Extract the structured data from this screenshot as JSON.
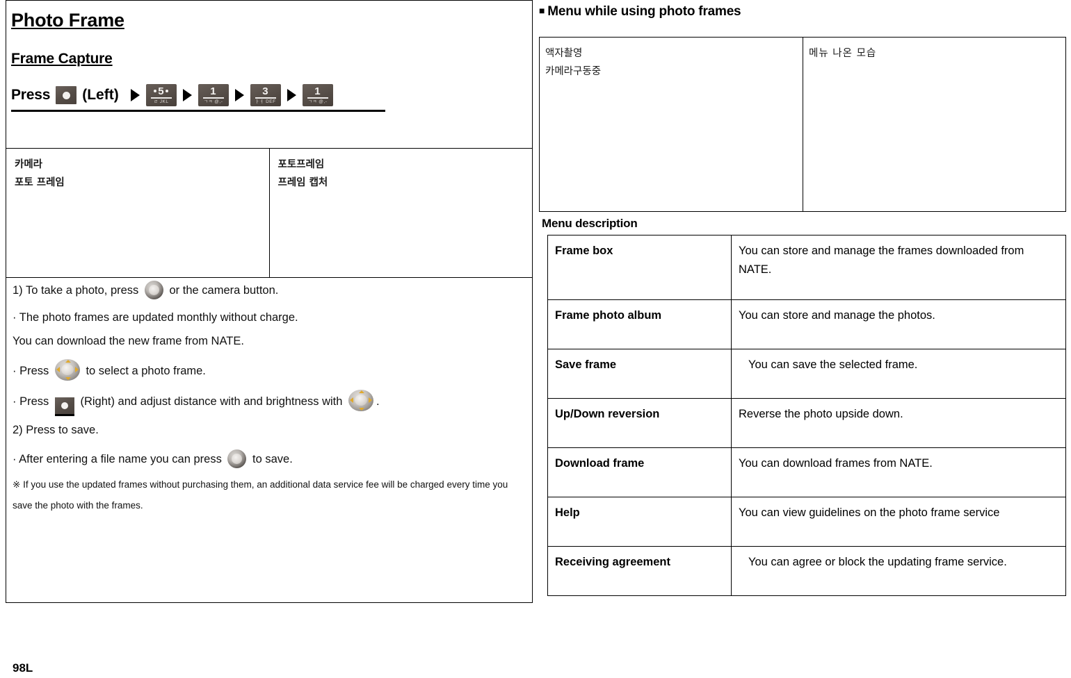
{
  "left": {
    "title": "Photo Frame",
    "subtitle": "Frame Capture",
    "press_label": "Press",
    "left_label": "(Left)",
    "key_sequence": [
      {
        "icon": "softkey-left",
        "digit": "",
        "sub": ""
      },
      {
        "icon": "numeric-key",
        "digit": "5",
        "sub": "ㄹ JKL",
        "dots": true
      },
      {
        "icon": "numeric-key",
        "digit": "1",
        "sub": "ㄱㅋ @,-",
        "dots": false
      },
      {
        "icon": "numeric-key",
        "digit": "3",
        "sub": "ㅏㅓ DEF",
        "dots": false
      },
      {
        "icon": "numeric-key",
        "digit": "1",
        "sub": "ㄱㅋ @,-",
        "dots": false
      }
    ],
    "screens": [
      {
        "line1": "카메라",
        "line2": "포토 프레임"
      },
      {
        "line1": "포토프레임",
        "line2": "프레임 캡처"
      }
    ],
    "steps": {
      "step1_pre": "1) To take a photo, press",
      "step1_post": "or the camera button.",
      "bullet1_a": "· The photo frames are updated monthly without charge.",
      "bullet1_b": "You can download the new frame from NATE.",
      "bullet2_pre": "· Press",
      "bullet2_post": "to select a photo frame.",
      "bullet3_pre": "· Press",
      "bullet3_mid": "(Right) and adjust distance with and brightness with",
      "bullet3_post": ".",
      "step2": "2) Press to save.",
      "bullet4_pre": "· After entering a file name you can press",
      "bullet4_post": "to save.",
      "note_symbol": "※",
      "note": "If you use the updated frames without purchasing them, an additional data service fee will be charged every time you save the photo with the frames."
    }
  },
  "right": {
    "heading": "Menu while using photo frames",
    "heading_bullet": "■",
    "preview": [
      {
        "line1": "액자촬영",
        "line2": "카메라구동중"
      },
      {
        "line1": "메뉴 나온 모습",
        "line2": ""
      }
    ],
    "menu_description_label": "Menu description",
    "menu_rows": [
      {
        "name": "Frame box",
        "desc": "You can store and manage the frames downloaded from NATE.",
        "indent": false
      },
      {
        "name": "Frame photo album",
        "desc": "You can store and manage the photos.",
        "indent": false
      },
      {
        "name": "Save frame",
        "desc": "You can save the selected frame.",
        "indent": true
      },
      {
        "name": "Up/Down reversion",
        "desc": "Reverse the photo upside down.",
        "indent": false
      },
      {
        "name": "Download frame",
        "desc": "You can download frames from NATE.",
        "indent": false
      },
      {
        "name": "Help",
        "desc": "You can view guidelines on the photo frame service",
        "indent": false
      },
      {
        "name": "Receiving agreement",
        "desc": "You can agree or block the updating frame service.",
        "indent": true
      }
    ]
  },
  "footer": {
    "page": "98L"
  }
}
